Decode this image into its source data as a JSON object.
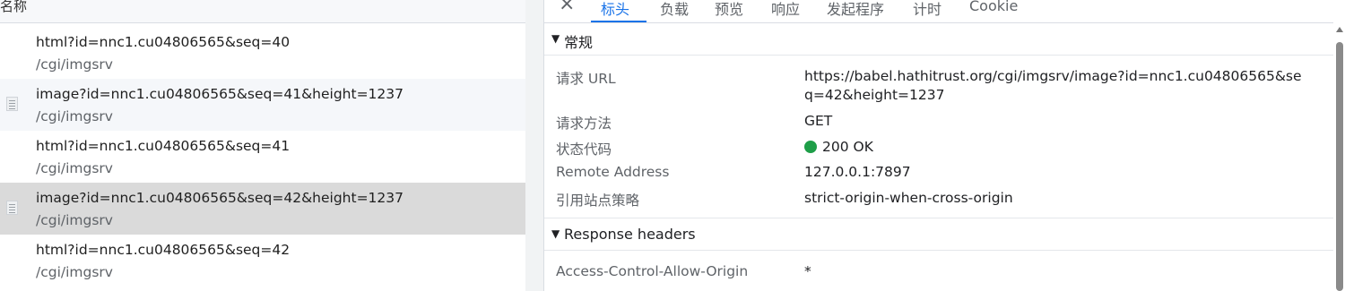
{
  "left_panel": {
    "column_header": "名称",
    "requests": [
      {
        "name": "html?id=nnc1.cu04806565&seq=40",
        "path": "/cgi/imgsrv",
        "has_thumb": false
      },
      {
        "name": "image?id=nnc1.cu04806565&seq=41&height=1237",
        "path": "/cgi/imgsrv",
        "has_thumb": true
      },
      {
        "name": "html?id=nnc1.cu04806565&seq=41",
        "path": "/cgi/imgsrv",
        "has_thumb": false
      },
      {
        "name": "image?id=nnc1.cu04806565&seq=42&height=1237",
        "path": "/cgi/imgsrv",
        "has_thumb": true,
        "selected": true
      },
      {
        "name": "html?id=nnc1.cu04806565&seq=42",
        "path": "/cgi/imgsrv",
        "has_thumb": false
      }
    ]
  },
  "tabs": {
    "close_icon": "×",
    "items": [
      "标头",
      "负载",
      "预览",
      "响应",
      "发起程序",
      "计时",
      "Cookie"
    ],
    "active": "标头"
  },
  "general": {
    "title": "常规",
    "toggle": "▼",
    "request_url_label": "请求 URL",
    "request_url_line1": "https://babel.hathitrust.org/cgi/imgsrv/image?id=nnc1.cu04806565&se",
    "request_url_line2": "q=42&height=1237",
    "method_label": "请求方法",
    "method_value": "GET",
    "status_label": "状态代码",
    "status_value": "200 OK",
    "status_color": "#1e9e48",
    "remote_label": "Remote Address",
    "remote_value": "127.0.0.1:7897",
    "referrer_label": "引用站点策略",
    "referrer_value": "strict-origin-when-cross-origin"
  },
  "response_headers": {
    "title": "Response headers",
    "toggle": "▼",
    "acao_label": "Access-Control-Allow-Origin",
    "acao_value": "*"
  },
  "colors": {
    "accent": "#1a73e8",
    "selected_row": "#dadada"
  }
}
